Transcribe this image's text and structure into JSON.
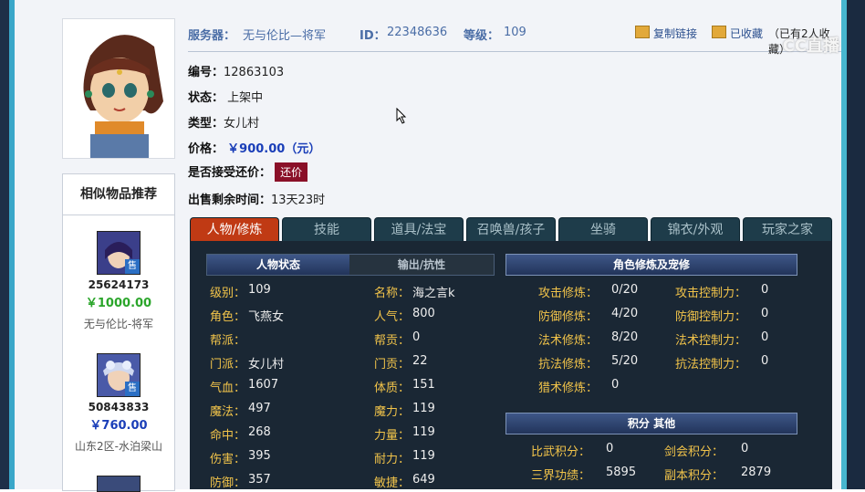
{
  "header": {
    "server_label": "服务器：",
    "server_value": "无与伦比—将军",
    "id_label": "ID：",
    "id_value": "22348636",
    "level_label": "等级：",
    "level_value": "109",
    "copy_link": "复制链接",
    "collected": "已收藏",
    "collect_count": "（已有2人收藏）"
  },
  "watermark": "CC直播",
  "info": {
    "number_label": "编号：",
    "number_value": "12863103",
    "status_label": "状态：",
    "status_value": "上架中",
    "type_label": "类型：",
    "type_value": "女儿村",
    "price_label": "价格：",
    "price_value": "￥900.00（元）",
    "bargain_label": "是否接受还价：",
    "bargain_button": "还价",
    "remaining_label": "出售剩余时间：",
    "remaining_value": "13天23时"
  },
  "similar": {
    "title": "相似物品推荐",
    "items": [
      {
        "badge": "售",
        "id": "25624173",
        "price": "￥1000.00",
        "price_color": "#2aa52a",
        "server": "无与伦比-将军"
      },
      {
        "badge": "售",
        "id": "50843833",
        "price": "￥760.00",
        "price_color": "#1a3eb8",
        "server": "山东2区-水泊梁山"
      }
    ]
  },
  "tabs": [
    "人物/修炼",
    "技能",
    "道具/法宝",
    "召唤兽/孩子",
    "坐骑",
    "锦衣/外观",
    "玩家之家"
  ],
  "subtabs": [
    "人物状态",
    "输出/抗性"
  ],
  "section_headers": {
    "cultivation": "角色修炼及宠修",
    "score": "积分  其他"
  },
  "stats_left": [
    {
      "label": "级别：",
      "value": "109"
    },
    {
      "label": "角色：",
      "value": "飞燕女"
    },
    {
      "label": "帮派：",
      "value": ""
    },
    {
      "label": "门派：",
      "value": "女儿村"
    },
    {
      "label": "气血：",
      "value": "1607"
    },
    {
      "label": "魔法：",
      "value": "497"
    },
    {
      "label": "命中：",
      "value": "268"
    },
    {
      "label": "伤害：",
      "value": "395"
    },
    {
      "label": "防御：",
      "value": "357"
    }
  ],
  "stats_mid": [
    {
      "label": "名称：",
      "value": "海之言k"
    },
    {
      "label": "人气：",
      "value": "800"
    },
    {
      "label": "帮贡：",
      "value": "0"
    },
    {
      "label": "门贡：",
      "value": "22"
    },
    {
      "label": "体质：",
      "value": "151"
    },
    {
      "label": "魔力：",
      "value": "119"
    },
    {
      "label": "力量：",
      "value": "119"
    },
    {
      "label": "耐力：",
      "value": "119"
    },
    {
      "label": "敏捷：",
      "value": "649"
    }
  ],
  "cultivation": [
    {
      "label": "攻击修炼：",
      "value": "0/20",
      "label2": "攻击控制力：",
      "value2": "0"
    },
    {
      "label": "防御修炼：",
      "value": "4/20",
      "label2": "防御控制力：",
      "value2": "0"
    },
    {
      "label": "法术修炼：",
      "value": "8/20",
      "label2": "法术控制力：",
      "value2": "0"
    },
    {
      "label": "抗法修炼：",
      "value": "5/20",
      "label2": "抗法控制力：",
      "value2": "0"
    },
    {
      "label": "猎术修炼：",
      "value": "0",
      "label2": "",
      "value2": ""
    }
  ],
  "scores": [
    {
      "label": "比武积分：",
      "value": "0",
      "label2": "剑会积分：",
      "value2": "0"
    },
    {
      "label": "三界功绩：",
      "value": "5895",
      "label2": "副本积分：",
      "value2": "2879"
    }
  ]
}
